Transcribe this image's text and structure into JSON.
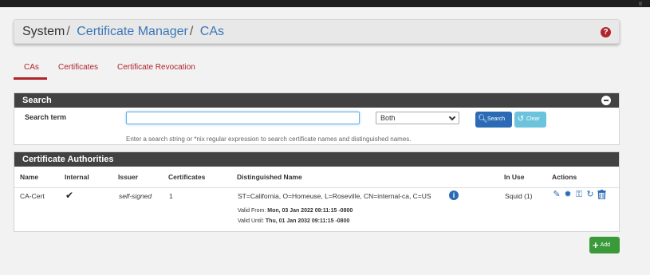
{
  "breadcrumb": {
    "root": "System",
    "section": "Certificate Manager",
    "current": "CAs",
    "separator": "/"
  },
  "help_icon": "?",
  "tabs": [
    {
      "label": "CAs",
      "active": true
    },
    {
      "label": "Certificates",
      "active": false
    },
    {
      "label": "Certificate Revocation",
      "active": false
    }
  ],
  "search": {
    "heading": "Search",
    "term_label": "Search term",
    "input_value": "",
    "scope_value": "Both",
    "search_button": "Search",
    "clear_button": "Clear",
    "help_text": "Enter a search string or *nix regular expression to search certificate names and distinguished names."
  },
  "ca_table": {
    "heading": "Certificate Authorities",
    "columns": [
      "Name",
      "Internal",
      "Issuer",
      "Certificates",
      "Distinguished Name",
      "In Use",
      "Actions"
    ],
    "rows": [
      {
        "name": "CA-Cert",
        "internal": "✔",
        "issuer": "self-signed",
        "certificates": "1",
        "dn": "ST=California, O=Homeuse, L=Roseville, CN=internal-ca, C=US",
        "valid_from_label": "Valid From:",
        "valid_from": "Mon, 03 Jan 2022 09:11:15 -0800",
        "valid_until_label": "Valid Until:",
        "valid_until": "Thu, 01 Jan 2032 09:11:15 -0800",
        "in_use": "Squid (1)"
      }
    ]
  },
  "add_button": "Add",
  "colors": {
    "accent_red": "#b0242a",
    "link_blue": "#3a77b8",
    "primary_blue": "#2b6bb5",
    "info_blue": "#6cc4dc",
    "success_green": "#3a9a3a",
    "panel_heading": "#424242"
  }
}
